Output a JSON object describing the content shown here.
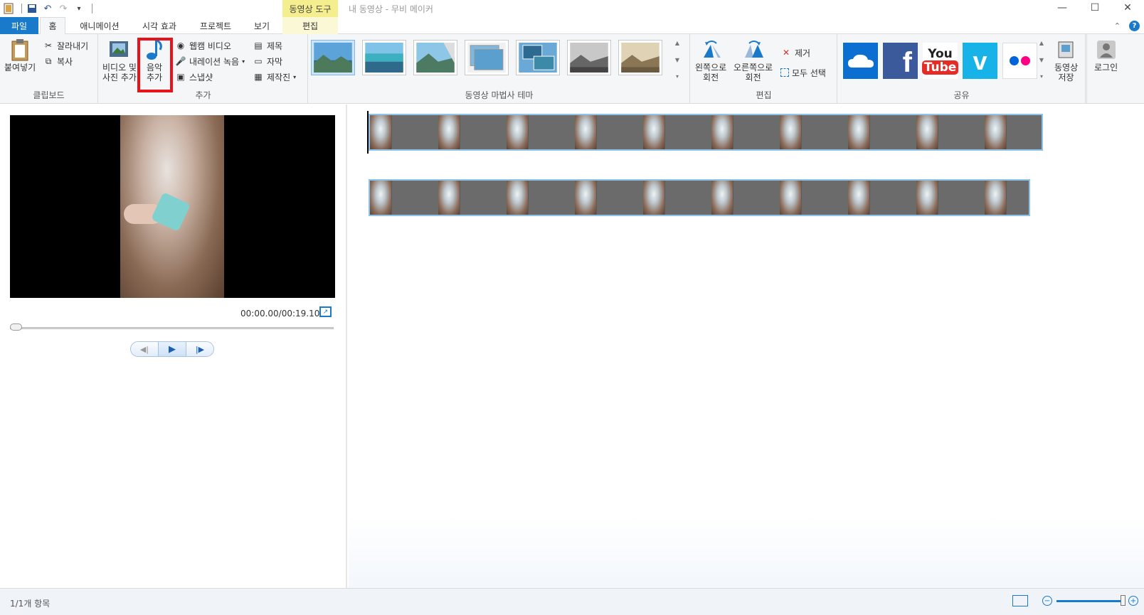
{
  "window": {
    "title": "내 동영상 - 무비 메이커",
    "context_tab_header": "동영상 도구"
  },
  "tabs": [
    {
      "label": "파일"
    },
    {
      "label": "홈"
    },
    {
      "label": "애니메이션"
    },
    {
      "label": "시각 효과"
    },
    {
      "label": "프로젝트"
    },
    {
      "label": "보기"
    },
    {
      "label": "편집"
    }
  ],
  "ribbon": {
    "clipboard": {
      "paste": "붙여넣기",
      "cut": "잘라내기",
      "copy": "복사",
      "label": "클립보드"
    },
    "add": {
      "video_photo_line1": "비디오 및",
      "video_photo_line2": "사진 추가",
      "music_line1": "음악",
      "music_line2": "추가",
      "webcam": "웹캠 비디오",
      "narration": "내레이션 녹음",
      "snapshot": "스냅샷",
      "title": "제목",
      "caption": "자막",
      "credits": "제작진",
      "label": "추가"
    },
    "themes": {
      "label": "동영상 마법사 테마",
      "count": 7
    },
    "editing": {
      "rotate_left_line1": "왼쪽으로",
      "rotate_left_line2": "회전",
      "rotate_right_line1": "오른쪽으로",
      "rotate_right_line2": "회전",
      "remove": "제거",
      "select_all": "모두 선택",
      "label": "편집"
    },
    "share": {
      "label": "공유",
      "save_line1": "동영상",
      "save_line2": "저장",
      "login": "로그인",
      "services": [
        "onedrive-icon",
        "facebook-icon",
        "youtube-icon",
        "vimeo-icon",
        "flickr-icon"
      ],
      "youtube_text_top": "You",
      "youtube_text_bottom": "Tube"
    }
  },
  "preview": {
    "timecode": "00:00.00/00:19.10",
    "progress": 0
  },
  "statusbar": {
    "items_text": "1/1개 항목"
  },
  "colors": {
    "accent": "#1979ca",
    "highlight": "#e8131a",
    "context_tab": "#f5ee8e"
  }
}
